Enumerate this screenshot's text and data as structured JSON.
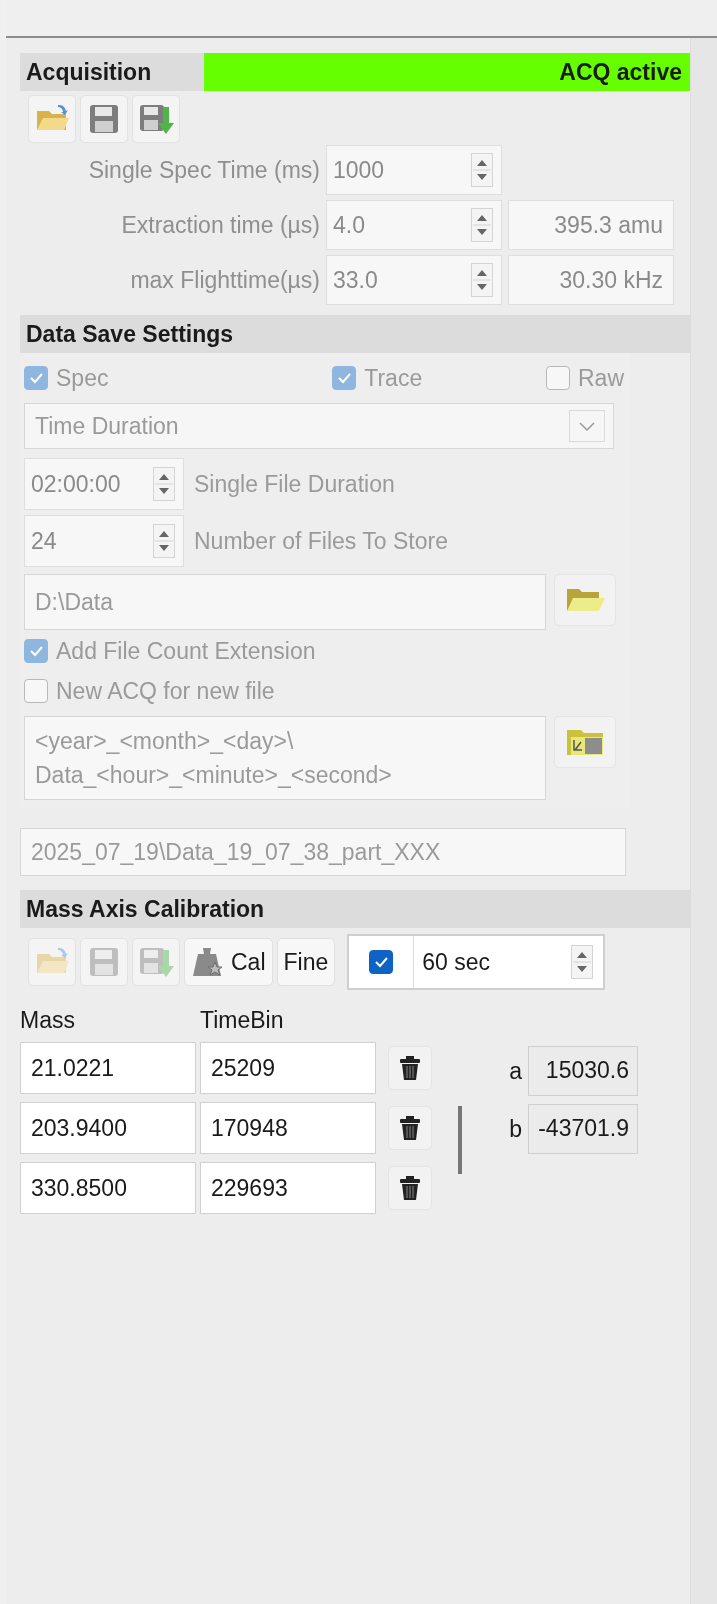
{
  "acquisition": {
    "title": "Acquisition",
    "status": "ACQ active",
    "active": true,
    "toolbar": [
      {
        "kind": "open",
        "disabled": false
      },
      {
        "kind": "save",
        "disabled": false
      },
      {
        "kind": "save_as",
        "disabled": false
      }
    ],
    "fields": [
      {
        "label": "Single Spec Time (ms)",
        "value": "1000"
      },
      {
        "label": "Extraction time (µs)",
        "value": "4.0",
        "readout": "395.3 amu"
      },
      {
        "label": "max Flighttime(µs)",
        "value": "33.0",
        "readout": "30.30 kHz"
      }
    ]
  },
  "data_save": {
    "title": "Data Save Settings",
    "disabled": true,
    "types": [
      {
        "label": "Spec",
        "checked": true
      },
      {
        "label": "Trace",
        "checked": true
      },
      {
        "label": "Raw",
        "checked": false
      }
    ],
    "mode": "Time Duration",
    "spins": [
      {
        "value": "02:00:00",
        "label": "Single File Duration"
      },
      {
        "value": "24",
        "label": "Number of Files To Store"
      }
    ],
    "folder": "D:\\Data",
    "options": [
      {
        "label": "Add File Count Extension",
        "checked": true
      },
      {
        "label": "New ACQ for new file",
        "checked": false
      }
    ],
    "template_lines": [
      "<year>_<month>_<day>\\",
      "Data_<hour>_<minute>_<second>"
    ],
    "preview": "2025_07_19\\Data_19_07_38_part_XXX"
  },
  "mass_calibration": {
    "title": "Mass Axis Calibration",
    "toolbar": [
      {
        "kind": "open",
        "disabled": true
      },
      {
        "kind": "save",
        "disabled": true
      },
      {
        "kind": "save_as",
        "disabled": true
      }
    ],
    "cal_button": "Cal",
    "fine_button": "Fine",
    "auto": {
      "checked": true,
      "value": "60 sec"
    },
    "columns": [
      "Mass",
      "TimeBin"
    ],
    "rows": [
      {
        "mass": "21.0221",
        "timebin": "25209"
      },
      {
        "mass": "203.9400",
        "timebin": "170948"
      },
      {
        "mass": "330.8500",
        "timebin": "229693"
      }
    ],
    "coefficients": [
      {
        "name": "a",
        "value": "15030.6"
      },
      {
        "name": "b",
        "value": "-43701.9"
      }
    ]
  }
}
